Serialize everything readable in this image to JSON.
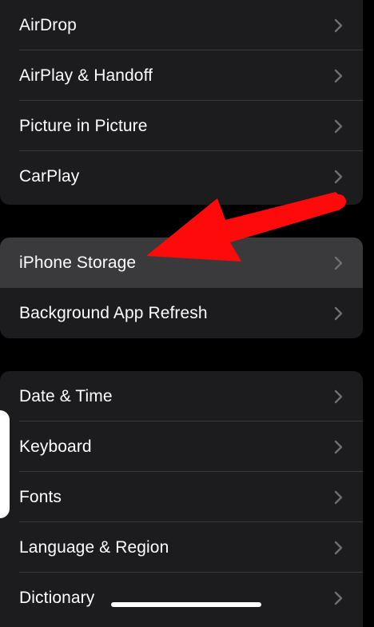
{
  "groups": [
    {
      "items": [
        {
          "label": "AirDrop"
        },
        {
          "label": "AirPlay & Handoff"
        },
        {
          "label": "Picture in Picture"
        },
        {
          "label": "CarPlay"
        }
      ]
    },
    {
      "items": [
        {
          "label": "iPhone Storage"
        },
        {
          "label": "Background App Refresh"
        }
      ]
    },
    {
      "items": [
        {
          "label": "Date & Time"
        },
        {
          "label": "Keyboard"
        },
        {
          "label": "Fonts"
        },
        {
          "label": "Language & Region"
        },
        {
          "label": "Dictionary"
        }
      ]
    }
  ],
  "colors": {
    "background": "#000000",
    "cell": "#1c1c1e",
    "highlight": "#3a3a3c",
    "chevron": "#6e6e73",
    "arrow": "#ff0a0a"
  },
  "icons": {
    "chevron": "chevron-right-icon",
    "annotation": "red-arrow-icon"
  }
}
